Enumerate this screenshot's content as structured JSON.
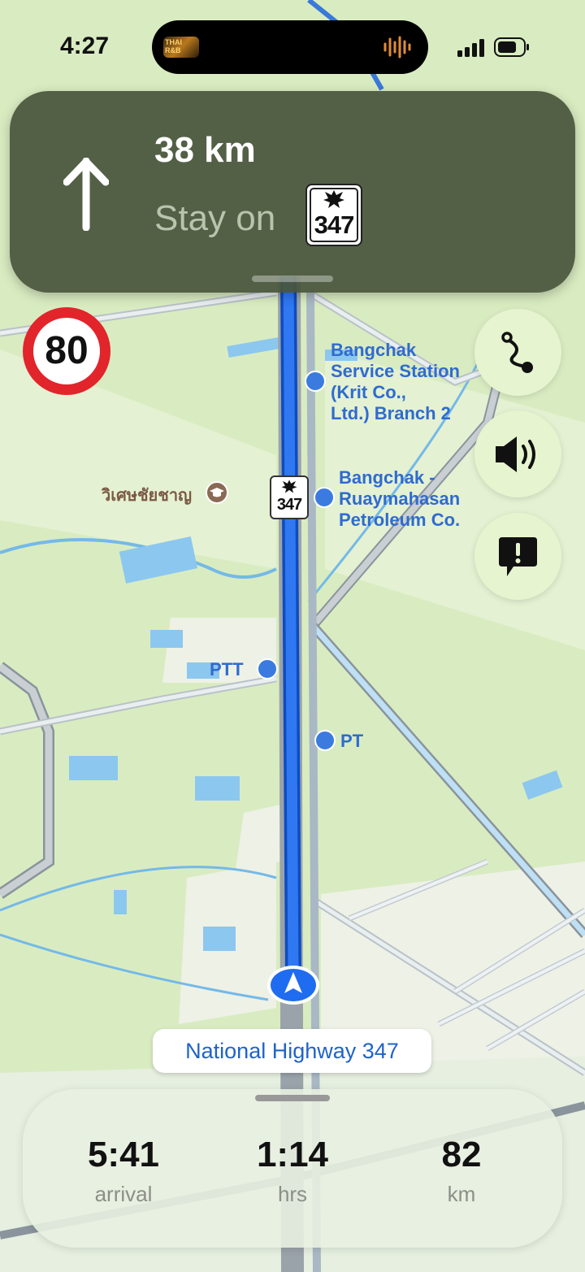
{
  "status_bar": {
    "time": "4:27",
    "now_playing_art_text": "THAI R&B"
  },
  "banner": {
    "distance": "38 km",
    "instruction": "Stay on",
    "route_number": "347",
    "direction_icon": "arrow-up-icon"
  },
  "speed_limit": "80",
  "controls": [
    {
      "name": "route-overview-button",
      "icon": "route-icon"
    },
    {
      "name": "audio-button",
      "icon": "speaker-icon"
    },
    {
      "name": "report-button",
      "icon": "exclamation-bubble-icon"
    }
  ],
  "map": {
    "pois": {
      "bangchak_1": "Bangchak\nService Station\n(Krit Co.,\nLtd.) Branch 2",
      "bangchak_2": "Bangchak -\nRuaymahasan\nPetroleum Co.",
      "ptt": "PTT",
      "pt": "PT",
      "school": "วิเศษชัยชาญ"
    },
    "road_shield": "347",
    "current_street": "National Highway 347"
  },
  "trip": {
    "arrival_value": "5:41",
    "arrival_label": "arrival",
    "duration_value": "1:14",
    "duration_label": "hrs",
    "distance_value": "82",
    "distance_label": "km"
  },
  "colors": {
    "map_background": "#d9ecc1",
    "route": "#1f6cf0",
    "banner": "#48553c",
    "speed_limit_ring": "#e2242b",
    "poi_blue": "#2f6bd0"
  }
}
